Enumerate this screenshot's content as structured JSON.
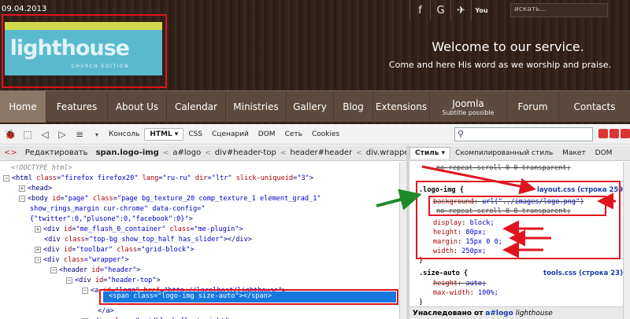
{
  "site": {
    "date": "09.04.2013",
    "logo_text": "lighthouse",
    "logo_sub": "CHURCH EDITION",
    "social_icons": [
      "facebook-icon",
      "google-icon",
      "twitter-icon",
      "youtube-icon"
    ],
    "social_glyphs": [
      "f",
      "G",
      "✈",
      "You"
    ],
    "search_placeholder": "искать...",
    "welcome": "Welcome to our service.",
    "tagline": "Come and here His word as we worship and praise.",
    "nav": [
      {
        "label": "Home",
        "active": true
      },
      {
        "label": "Features"
      },
      {
        "label": "About Us"
      },
      {
        "label": "Calendar"
      },
      {
        "label": "Ministries"
      },
      {
        "label": "Gallery"
      },
      {
        "label": "Blog"
      },
      {
        "label": "Extensions"
      },
      {
        "label": "Joomla",
        "sub": "Subtitle possible"
      },
      {
        "label": "Forum"
      },
      {
        "label": "Contacts"
      }
    ]
  },
  "toolbar": {
    "console": "Консоль",
    "html": "HTML ▾",
    "css": "CSS",
    "script": "Сценарий",
    "dom": "DOM",
    "net": "Сеть",
    "cookies": "Cookies",
    "search_icon": "⚲"
  },
  "crumbs": {
    "edit": "Редактировать",
    "items": [
      "span.logo-img",
      "a#logo",
      "div#header-top",
      "header#header",
      "div.wrapper"
    ]
  },
  "style_tabs": [
    "Стиль ▾",
    "Скомпилированный стиль",
    "Макет",
    "DOM"
  ],
  "tree": {
    "doctype": "<!DOCTYPE html>",
    "html": {
      "tag": "html",
      "attrs": [
        [
          "class",
          "firefox firefox20"
        ],
        [
          "lang",
          "ru-ru"
        ],
        [
          "dir",
          "ltr"
        ],
        [
          "slick-uniqueid",
          "3"
        ]
      ]
    },
    "head": "<head>",
    "body": {
      "tag": "body",
      "attrs": [
        [
          "id",
          "page"
        ],
        [
          "class",
          "page bg_texture_20 comp_texture_1 element_grad_1"
        ]
      ]
    },
    "body_cont": "show_rings_margin cur-chrome\" data-config=\"",
    "body_cont2": "{\"twitter\":0,\"plusone\":0,\"facebook\":0}\">",
    "flash": {
      "tag": "div",
      "attrs": [
        [
          "id",
          "me_flash_0_container"
        ],
        [
          "class",
          "me-plugin"
        ]
      ]
    },
    "topbg": {
      "tag": "div",
      "attrs": [
        [
          "class",
          "top-bg show_top_half has_slider"
        ]
      ]
    },
    "toolbar": {
      "tag": "div",
      "attrs": [
        [
          "id",
          "toolbar"
        ],
        [
          "class",
          "grid-block"
        ]
      ]
    },
    "wrapper": {
      "tag": "div",
      "attrs": [
        [
          "class",
          "wrapper"
        ]
      ]
    },
    "header": {
      "tag": "header",
      "attrs": [
        [
          "id",
          "header"
        ]
      ]
    },
    "headertop": {
      "tag": "div",
      "attrs": [
        [
          "id",
          "header-top"
        ]
      ]
    },
    "alogo": {
      "tag": "a",
      "attrs": [
        [
          "id",
          "logo"
        ],
        [
          "href",
          "http://localhost/lighthouse"
        ]
      ]
    },
    "span": {
      "tag": "span",
      "attrs": [
        [
          "class",
          "logo-img size-auto"
        ]
      ]
    },
    "aclose": "</a>",
    "gridblock": {
      "tag": "div",
      "attrs": [
        [
          "class",
          "gridblock float-right"
        ]
      ]
    }
  },
  "styles": {
    "top_strike": "no-repeat scroll 0 0 transparent;",
    "rule1_selector": ".logo-img {",
    "rule1_source": "layout.css (строка 259)",
    "bg_prop": "background:",
    "bg_val": "url(\"../images/logo.png\")",
    "bg_cont": "no-repeat scroll 0 0 transparent;",
    "props": [
      {
        "name": "display",
        "value": "block;"
      },
      {
        "name": "height",
        "value": "80px;"
      },
      {
        "name": "margin",
        "value": "15px 0 0;"
      },
      {
        "name": "width",
        "value": "250px;"
      }
    ],
    "close": "}",
    "rule2_selector": ".size-auto {",
    "rule2_source": "tools.css (строка 23)",
    "rule2_props": [
      {
        "name": "height",
        "value": "auto;",
        "strike": true
      },
      {
        "name": "max-width",
        "value": "100%;"
      }
    ],
    "inherited_label": "Унаследовано от",
    "inherited_el": "a#logo",
    "inherited_name": "lighthouse"
  },
  "colors": {
    "annotation": "#e0141e",
    "arrow_green": "#1f8a2a",
    "selection": "#1678de"
  }
}
